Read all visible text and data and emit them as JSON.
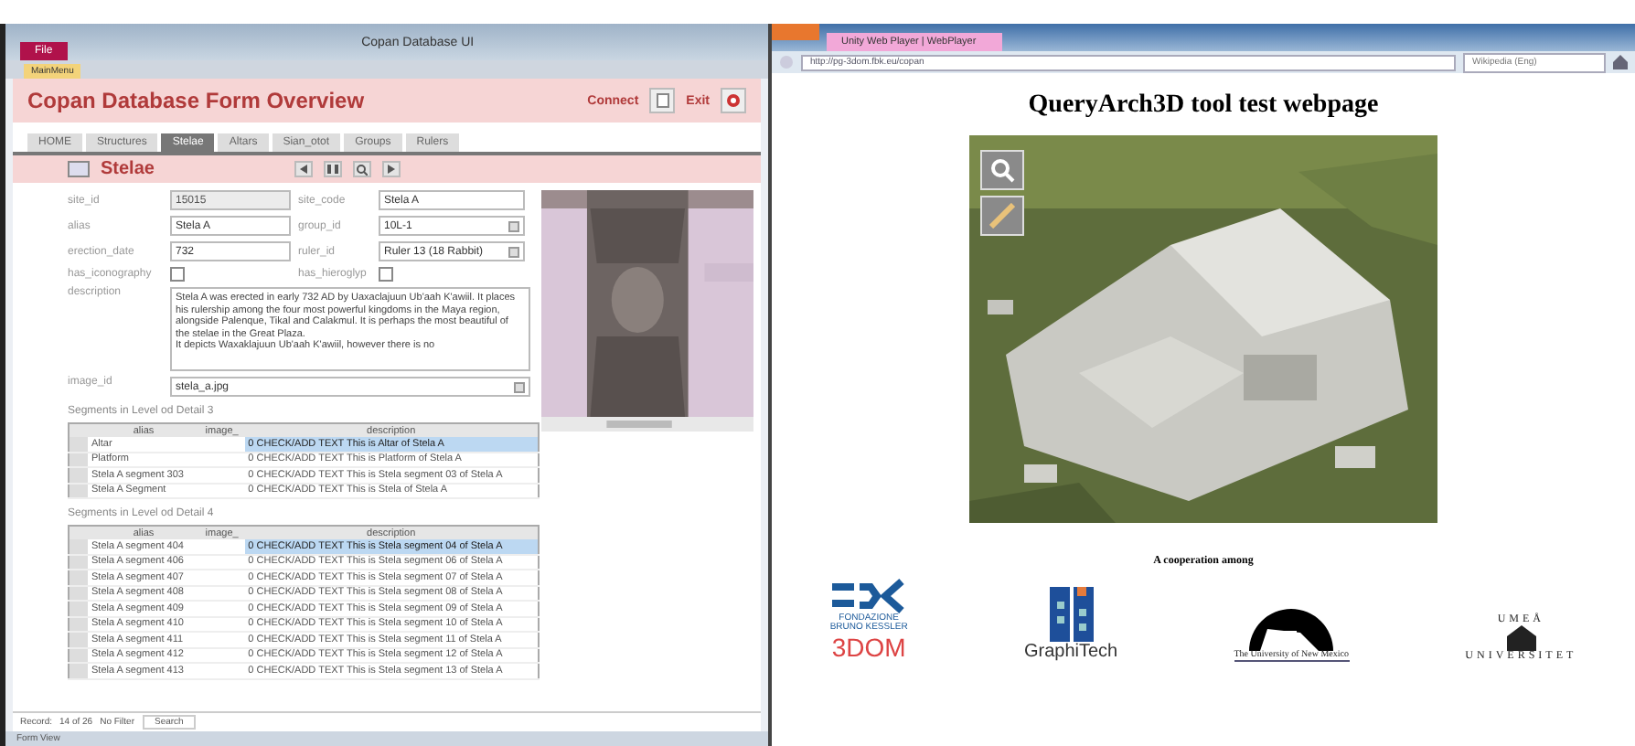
{
  "access_window": {
    "title": "Copan Database UI",
    "file_tab": "File",
    "object_tab": "MainMenu",
    "form_title": "Copan Database Form Overview",
    "header_buttons": [
      {
        "label": "Connect",
        "kind": "document"
      },
      {
        "label": "Exit",
        "kind": "exit"
      }
    ],
    "tabs": [
      {
        "label": "HOME",
        "selected": false
      },
      {
        "label": "Structures",
        "selected": false
      },
      {
        "label": "Stelae",
        "selected": true
      },
      {
        "label": "Altars",
        "selected": false
      },
      {
        "label": "Sian_otot",
        "selected": false
      },
      {
        "label": "Groups",
        "selected": false
      },
      {
        "label": "Rulers",
        "selected": false
      }
    ],
    "section_title": "Stelae",
    "form_rows": [
      [
        {
          "label": "site_id",
          "value": "15015",
          "kind": "readonly"
        },
        {
          "label": "site_code",
          "value": "Stela A",
          "kind": "text"
        }
      ],
      [
        {
          "label": "alias",
          "value": "Stela A",
          "kind": "text"
        },
        {
          "label": "group_id",
          "value": "10L-1",
          "kind": "combo"
        }
      ],
      [
        {
          "label": "erection_date",
          "value": "732",
          "kind": "text"
        },
        {
          "label": "ruler_id",
          "value": "Ruler 13 (18 Rabbit)",
          "kind": "combo"
        }
      ],
      [
        {
          "label": "has_iconography",
          "kind": "checkbox",
          "checked": false
        },
        {
          "label": "has_hieroglyp",
          "kind": "checkbox",
          "checked": false
        }
      ]
    ],
    "description": {
      "label": "description",
      "lines": [
        "Stela A was erected in early 732 AD by Uaxaclajuun Ub'aah K'awiil. It places his rulership among the four most powerful kingdoms in the Maya region, alongside Palenque, Tikal and Calakmul. It is perhaps the most beautiful of the stelae in the Great Plaza.",
        "It depicts Waxaklajuun Ub'aah K'awiil, however there is no"
      ]
    },
    "image_field": {
      "label": "image_id",
      "value": "stela_a.jpg"
    },
    "lod_tables": [
      {
        "title": "Segments in Level od Detail 3",
        "columns": [
          "alias",
          "image_",
          "description"
        ],
        "rows": [
          {
            "alias": "Altar",
            "description": "0 CHECK/ADD TEXT This is Altar of Stela A",
            "selected": true
          },
          {
            "alias": "Platform",
            "description": "0 CHECK/ADD TEXT This is Platform of Stela A",
            "selected": false
          },
          {
            "alias": "Stela A segment 303",
            "description": "0 CHECK/ADD TEXT This is Stela segment 03 of Stela A",
            "selected": false
          },
          {
            "alias": "Stela A Segment",
            "description": "0 CHECK/ADD TEXT This is Stela of Stela A",
            "selected": false
          }
        ]
      },
      {
        "title": "Segments in Level od Detail 4",
        "columns": [
          "alias",
          "image_",
          "description"
        ],
        "rows": [
          {
            "alias": "Stela A segment 404",
            "description": "0 CHECK/ADD TEXT This is Stela segment 04 of Stela A",
            "selected": true
          },
          {
            "alias": "Stela A segment 406",
            "description": "0 CHECK/ADD TEXT This is Stela segment 06 of Stela A",
            "selected": false
          },
          {
            "alias": "Stela A segment 407",
            "description": "0 CHECK/ADD TEXT This is Stela segment 07 of Stela A",
            "selected": false
          },
          {
            "alias": "Stela A segment 408",
            "description": "0 CHECK/ADD TEXT This is Stela segment 08 of Stela A",
            "selected": false
          },
          {
            "alias": "Stela A segment 409",
            "description": "0 CHECK/ADD TEXT This is Stela segment 09 of Stela A",
            "selected": false
          },
          {
            "alias": "Stela A segment 410",
            "description": "0 CHECK/ADD TEXT This is Stela segment 10 of Stela A",
            "selected": false
          },
          {
            "alias": "Stela A segment 411",
            "description": "0 CHECK/ADD TEXT This is Stela segment 11 of Stela A",
            "selected": false
          },
          {
            "alias": "Stela A segment 412",
            "description": "0 CHECK/ADD TEXT This is Stela segment 12 of Stela A",
            "selected": false
          },
          {
            "alias": "Stela A segment 413",
            "description": "0 CHECK/ADD TEXT This is Stela segment 13 of Stela A",
            "selected": false
          }
        ]
      }
    ],
    "record_nav": {
      "label": "Record:",
      "position": "14 of 26",
      "filter": "No Filter",
      "search": "Search"
    },
    "status_bar": {
      "text": "Form View"
    }
  },
  "browser": {
    "tab_title": "Unity Web Player | WebPlayer",
    "url": "http://pg-3dom.fbk.eu/copan",
    "search_placeholder": "Wikipedia (Eng)",
    "page_title": "QueryArch3D tool test webpage",
    "caption": "A cooperation among",
    "logos": [
      {
        "kind": "fbk",
        "lines": [
          "FONDAZIONE",
          "BRUNO KESSLER",
          "3DOM"
        ]
      },
      {
        "kind": "graphitech",
        "lines": [
          "GraphiTech"
        ]
      },
      {
        "kind": "unm",
        "lines": [
          "The University of New Mexico"
        ]
      },
      {
        "kind": "umea",
        "lines": [
          "UMEÅ",
          "UNIVERSITET"
        ]
      }
    ]
  }
}
